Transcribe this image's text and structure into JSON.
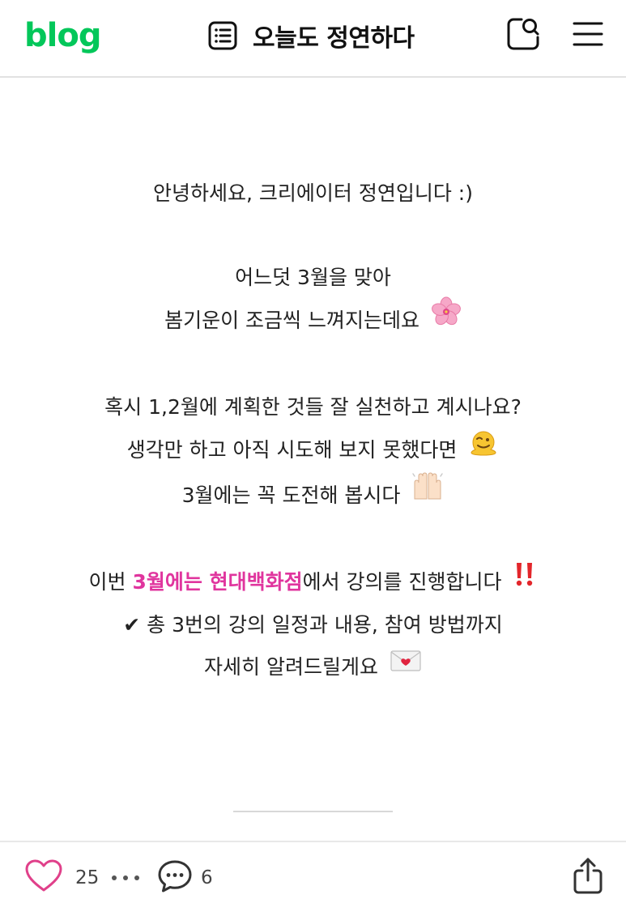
{
  "header": {
    "logo": "blog",
    "blog_title": "오늘도 정연하다",
    "icons": {
      "title": "list-icon",
      "search": "search-icon",
      "menu": "hamburger-menu-icon"
    }
  },
  "post": {
    "greeting": "안녕하세요, 크리에이터 정연입니다 :)",
    "spring_line1": "어느덧 3월을 맞아",
    "spring_line2": "봄기운이 조금씩 느껴지는데요",
    "plan_line1": "혹시 1,2월에 계획한 것들 잘 실천하고 계시나요?",
    "plan_line2": "생각만 하고 아직 시도해 보지 못했다면",
    "plan_line3": "3월에는 꼭 도전해 봅시다",
    "lecture_prefix": "이번 ",
    "lecture_highlight": "3월에는 현대백화점",
    "lecture_suffix": "에서 강의를 진행합니다",
    "detail_line1": "✔ 총 3번의 강의 일정과 내용, 참여 방법까지",
    "detail_line2": "자세히 알려드릴게요",
    "emojis": {
      "blossom": "cherry-blossom-emoji",
      "melting": "melting-face-emoji",
      "hands": "raised-hands-emoji",
      "bang": "double-exclamation-emoji",
      "letter": "love-letter-emoji"
    },
    "colors": {
      "highlight": "#e0359e",
      "brand": "#03c75a"
    }
  },
  "footer": {
    "like_count": "25",
    "more_label": "•••",
    "comment_count": "6",
    "icons": {
      "like": "heart-icon",
      "comment": "comment-icon",
      "share": "share-icon"
    }
  }
}
